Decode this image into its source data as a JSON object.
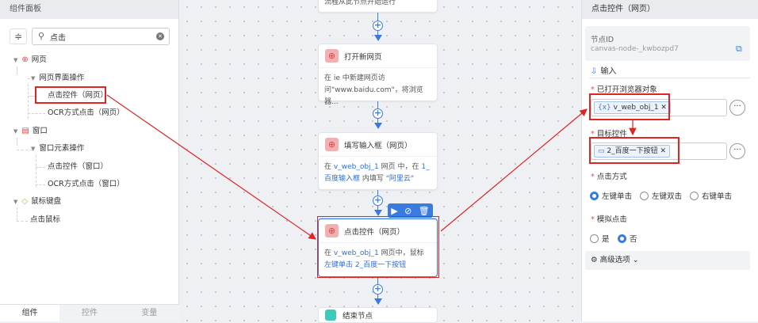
{
  "left_panel": {
    "title": "组件面板",
    "search": {
      "value": "点击",
      "placeholder": ""
    },
    "tree": {
      "web": "网页",
      "web_ops": "网页界面操作",
      "click_web": "点击控件（网页）",
      "ocr_web": "OCR方式点击（网页）",
      "window": "窗口",
      "window_ops": "窗口元素操作",
      "click_window": "点击控件（窗口）",
      "ocr_window": "OCR方式点击（窗口）",
      "mouse_kb": "鼠标键盘",
      "click_mouse": "点击鼠标"
    },
    "tabs": [
      "组件",
      "控件",
      "变量"
    ]
  },
  "canvas": {
    "top_node_partial": "流程从此节点开始运行",
    "node1": {
      "title": "打开新网页",
      "body": "在 ie 中新建网页访问\"www.baidu.com\"，将浏览器..."
    },
    "node2": {
      "title": "填写输入框（网页）",
      "b1": "在",
      "var": "v_web_obj_1",
      "b2": "网页 中，在",
      "target": "1_百度输入框",
      "b3": "内填写",
      "text": "\"阿里云\""
    },
    "node3": {
      "title": "点击控件（网页）",
      "b1": "在",
      "var": "v_web_obj_1",
      "b2": "网页中，鼠标",
      "action": "左键单击",
      "target": "2_百度一下按钮"
    },
    "end_node": "结束节点"
  },
  "right_panel": {
    "title": "点击控件（网页）",
    "node_id_label": "节点ID",
    "node_id_value": "canvas-node-_kwbozpd7",
    "input_section": "输入",
    "browser_label": "已打开浏览器对象",
    "browser_value": "v_web_obj_1",
    "target_label": "目标控件",
    "target_value": "2_百度一下按钮",
    "click_mode_label": "点击方式",
    "click_modes": [
      "左键单击",
      "左键双击",
      "右键单击"
    ],
    "click_mode_selected": 0,
    "simulate_label": "模拟点击",
    "simulate_options": [
      "是",
      "否"
    ],
    "simulate_selected": 1,
    "advanced": "高级选项"
  },
  "colors": {
    "accent": "#3a7be0",
    "annotation": "#e02424",
    "web_icon": "#d94848"
  }
}
